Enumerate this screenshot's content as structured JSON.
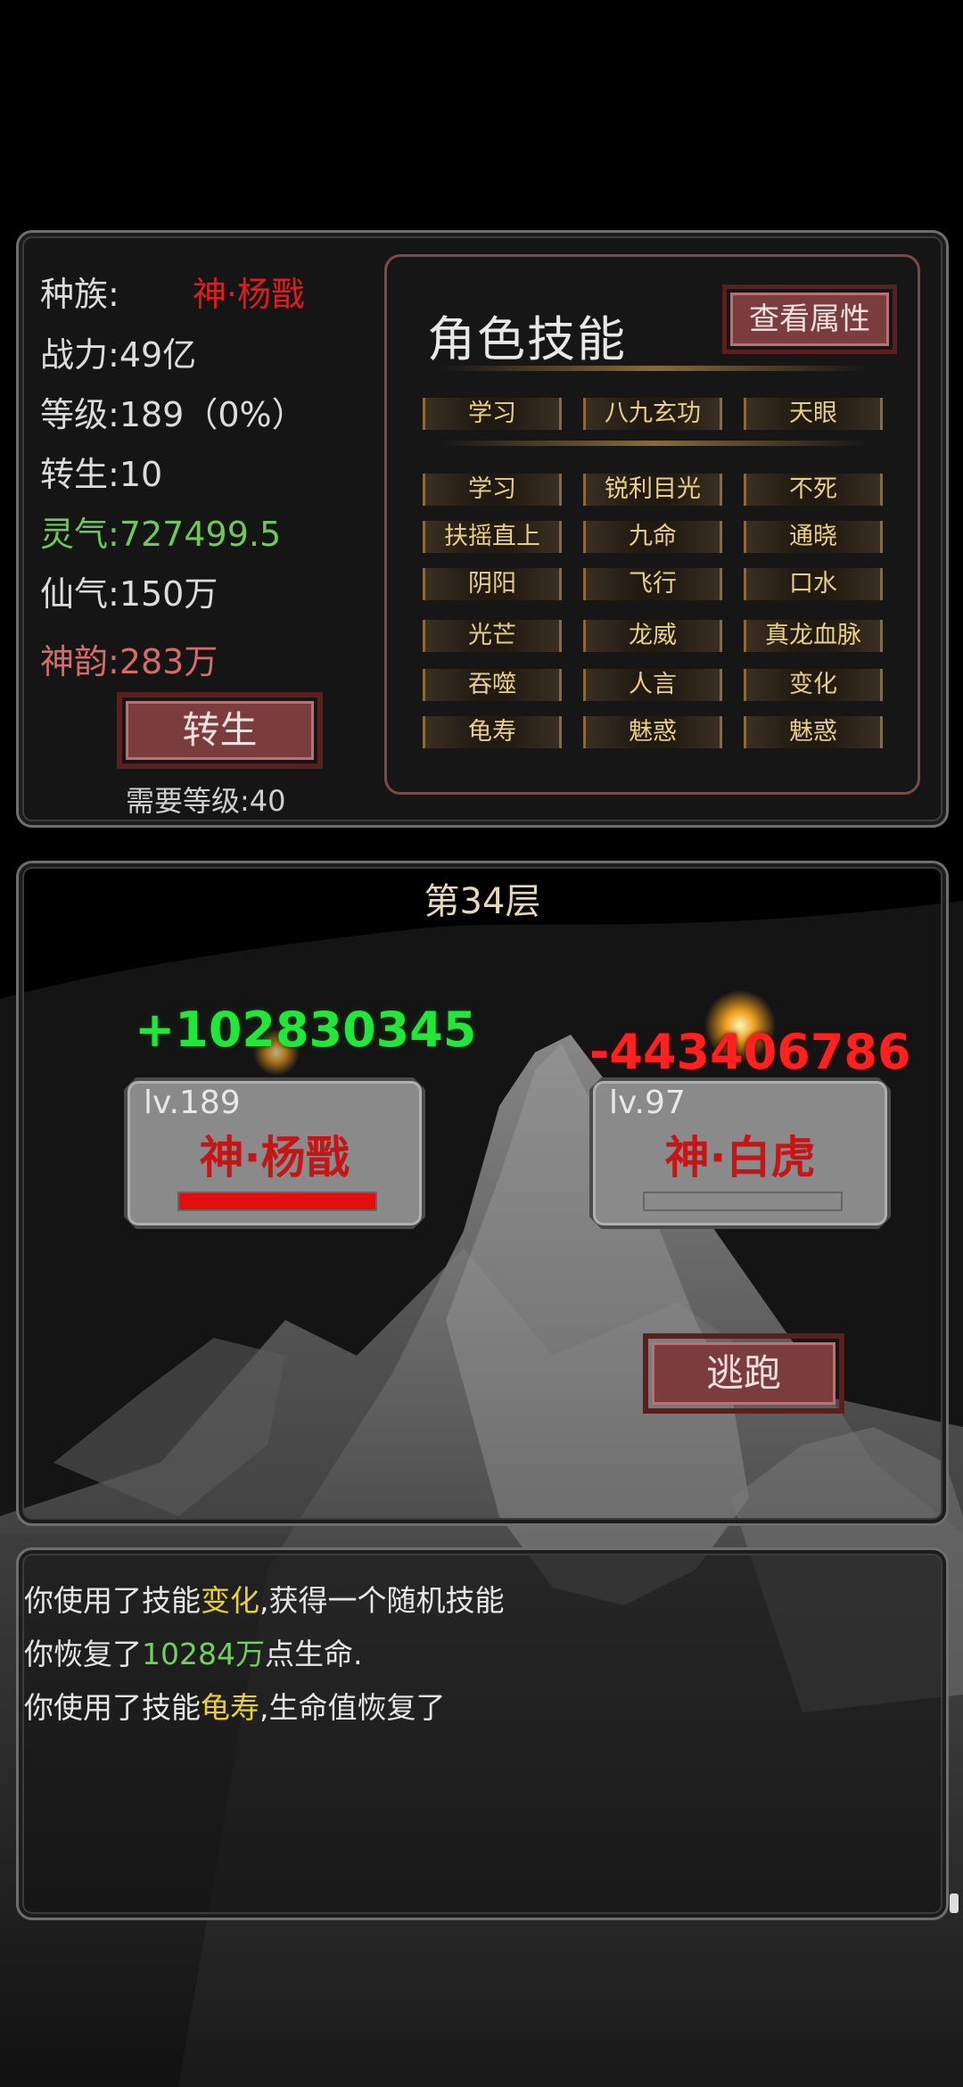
{
  "stats": {
    "race": {
      "label": "种族:",
      "value": "神·杨戬",
      "color": "#e21b1b"
    },
    "power": {
      "label": "战力:",
      "value": "49亿"
    },
    "level": {
      "label": "等级:",
      "value": "189（0%）"
    },
    "rebirth": {
      "label": "转生:",
      "value": "10"
    },
    "lingqi": {
      "label": "灵气:",
      "value": "727499.5",
      "color": "#6fc85a"
    },
    "xianqi": {
      "label": "仙气:",
      "value": "150万"
    },
    "shenyun": {
      "label": "神韵:",
      "value": "283万",
      "color": "#d96a6a"
    }
  },
  "rebirth_button": {
    "label": "转生",
    "requirement": "需要等级:40"
  },
  "skills_panel": {
    "title": "角色技能",
    "view_attributes_label": "查看属性",
    "row_first": [
      "学习",
      "八九玄功",
      "天眼"
    ],
    "rows": [
      [
        "学习",
        "锐利目光",
        "不死"
      ],
      [
        "扶摇直上",
        "九命",
        "通晓"
      ],
      [
        "阴阳",
        "飞行",
        "口水"
      ],
      [
        "光芒",
        "龙威",
        "真龙血脉"
      ],
      [
        "吞噬",
        "人言",
        "变化"
      ],
      [
        "龟寿",
        "魅惑",
        "魅惑"
      ]
    ]
  },
  "battle": {
    "floor": "第34层",
    "player": {
      "level": "lv.189",
      "name": "神·杨戬",
      "damage_text": "+102830345",
      "hp_fraction": 1.0,
      "hp_color": "#e30e0e"
    },
    "enemy": {
      "level": "lv.97",
      "name": "神·白虎",
      "damage_text": "-443406786",
      "hp_fraction": 0.0,
      "hp_color": "#8a8a8a"
    },
    "flee_label": "逃跑",
    "heal_color": "#22e63a",
    "damage_color": "#ff2020"
  },
  "log": [
    {
      "pre": "你使用了技能",
      "hl": "变化",
      "post": ",获得一个随机技能",
      "hl_color": "#e8cf3a"
    },
    {
      "pre": "你恢复了",
      "hl": "10284万",
      "post": "点生命.",
      "hl_color": "#6fd25a"
    },
    {
      "pre": "你使用了技能",
      "hl": "龟寿",
      "post": ",生命值恢复了",
      "hl_color": "#e8cf3a"
    }
  ]
}
